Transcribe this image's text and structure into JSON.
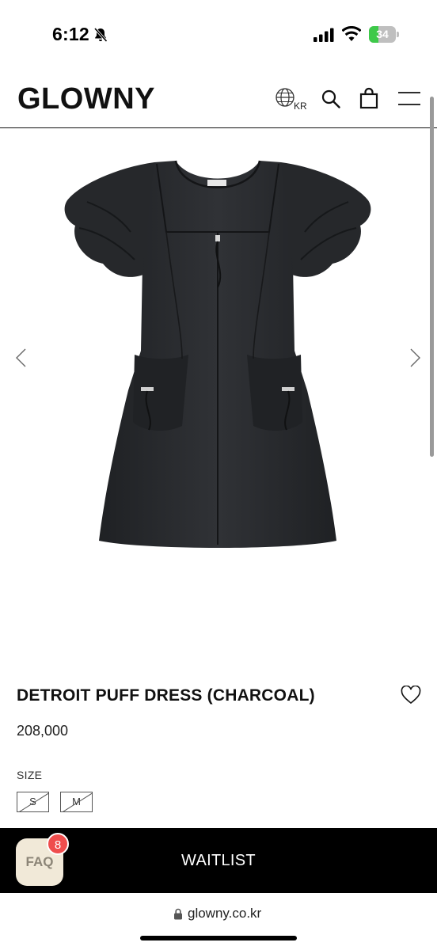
{
  "status_bar": {
    "time": "6:12",
    "battery_percent": 34,
    "battery_label": "34"
  },
  "header": {
    "logo": "GLOWNY",
    "language_code": "KR",
    "icons": [
      "globe-icon",
      "search-icon",
      "bag-icon",
      "menu-icon"
    ]
  },
  "gallery": {
    "icons": [
      "arrow-left-icon",
      "arrow-right-icon"
    ],
    "image_color": "#2b2d31"
  },
  "product": {
    "title": "DETROIT PUFF DRESS (CHARCOAL)",
    "price": "208,000",
    "size_label": "SIZE",
    "sizes": [
      {
        "label": "S",
        "available": false
      },
      {
        "label": "M",
        "available": false
      }
    ]
  },
  "cta": {
    "waitlist_label": "WAITLIST"
  },
  "faq": {
    "label": "FAQ",
    "badge_count": "8",
    "background": "#f1e9d8",
    "badge_color": "#ef4d4d"
  },
  "browser": {
    "url": "glowny.co.kr"
  }
}
